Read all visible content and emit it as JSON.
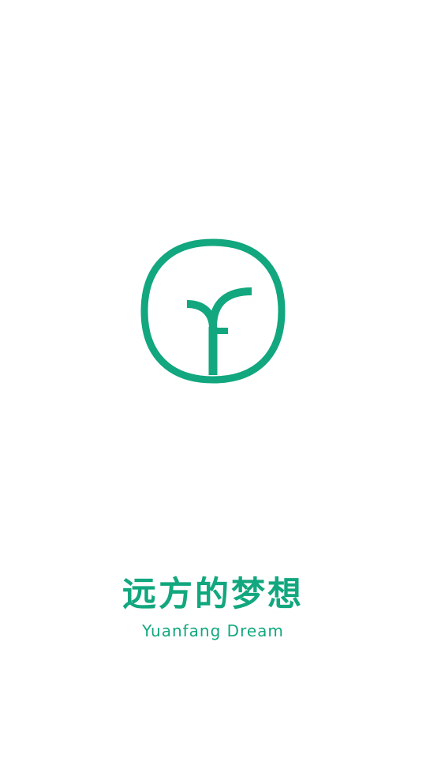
{
  "splash": {
    "logo_icon": "sprout-in-circle-logo",
    "brand_color": "#12A77E",
    "app_name_cn": "远方的梦想",
    "app_name_en": "Yuanfang Dream"
  }
}
